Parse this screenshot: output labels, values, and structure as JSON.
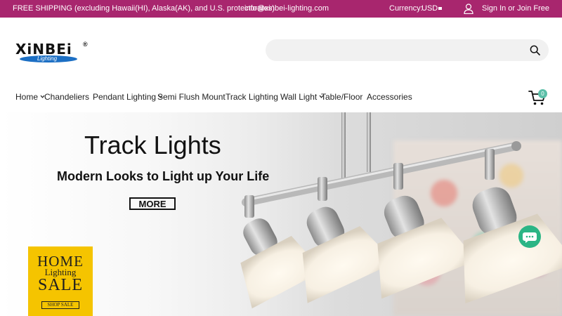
{
  "topbar": {
    "shipping": "FREE SHIPPING (excluding Hawaii(HI), Alaska(AK), and U.S. protectorates)",
    "email": "info@xinbei-lighting.com",
    "currency_label": "Currency:",
    "currency_value": "USD",
    "signin": "Sign In or Join Free",
    "bg_color": "#a8266e"
  },
  "logo": {
    "brand": "XiNBEi",
    "reg": "®",
    "sub": "Lighting"
  },
  "search": {
    "value": "",
    "placeholder": ""
  },
  "nav": {
    "items": [
      {
        "label": "Home",
        "has_dropdown": true
      },
      {
        "label": "Chandeliers",
        "has_dropdown": false
      },
      {
        "label": "Pendant Lighting",
        "has_dropdown": true
      },
      {
        "label": "Semi Flush Mount",
        "has_dropdown": false
      },
      {
        "label": "Track Lighting",
        "has_dropdown": false
      },
      {
        "label": "Wall Light",
        "has_dropdown": true
      },
      {
        "label": "Table/Floor",
        "has_dropdown": false
      },
      {
        "label": "Accessories",
        "has_dropdown": false
      }
    ]
  },
  "cart": {
    "count": "0",
    "badge_color": "#5bbfa8"
  },
  "hero": {
    "title": "Track Lights",
    "subtitle": "Modern Looks to Light up Your Life",
    "button": "MORE"
  },
  "promo": {
    "line1": "HOME",
    "line2": "Lighting",
    "line3": "SALE",
    "button": "SHOP SALE",
    "bg_color": "#f5c400"
  },
  "chat": {
    "color": "#2bb585"
  }
}
